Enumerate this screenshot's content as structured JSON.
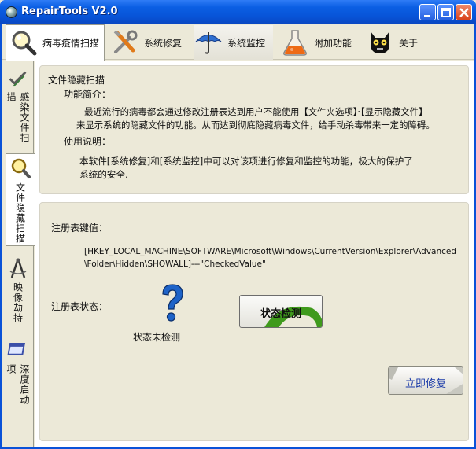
{
  "window": {
    "title": "RepairTools V2.0"
  },
  "top_tabs": [
    {
      "label": "病毒疫情扫描",
      "icon": "magnifier-icon",
      "active": true
    },
    {
      "label": "系统修复",
      "icon": "tools-icon",
      "active": false
    },
    {
      "label": "系统监控",
      "icon": "umbrella-icon",
      "active": false
    },
    {
      "label": "附加功能",
      "icon": "flask-icon",
      "active": false
    },
    {
      "label": "关于",
      "icon": "black-cat-icon",
      "active": false
    }
  ],
  "left_tabs": [
    {
      "label": "感染文件扫描",
      "icon": "checklist-icon",
      "active": false
    },
    {
      "label": "文件隐藏扫描",
      "icon": "magnifier-icon",
      "active": true
    },
    {
      "label": "映像劫持",
      "icon": "compass-icon",
      "active": false
    },
    {
      "label": "深度启动项",
      "icon": "window-icon",
      "active": false
    }
  ],
  "info_panel": {
    "heading": "文件隐藏扫描",
    "intro_label": "功能简介：",
    "intro_line1": "最近流行的病毒都会通过修改注册表达到用户不能使用【文件夹选项】·【显示隐藏文件】",
    "intro_line2": "来显示系统的隐藏文件的功能。从而达到彻底隐藏病毒文件，给手动杀毒带来一定的障碍。",
    "usage_label": "使用说明：",
    "usage_line1": "本软件[系统修复]和[系统监控]中可以对该项进行修复和监控的功能，极大的保护了",
    "usage_line2": "系统的安全."
  },
  "registry_panel": {
    "key_label": "注册表键值：",
    "key_line1": "[HKEY_LOCAL_MACHINE\\SOFTWARE\\Microsoft\\Windows\\CurrentVersion\\Explorer\\Advanced",
    "key_line2": "\\Folder\\Hidden\\SHOWALL]---\"CheckedValue\"",
    "status_label": "注册表状态：",
    "status_value": "状态未检测",
    "check_button": "状态检测",
    "fix_button": "立即修复"
  },
  "colors": {
    "titlebar": "#0754d8",
    "face": "#ece9d8",
    "accent_blue": "#1a3aa8",
    "check_button_green": "#3f9a1c"
  }
}
